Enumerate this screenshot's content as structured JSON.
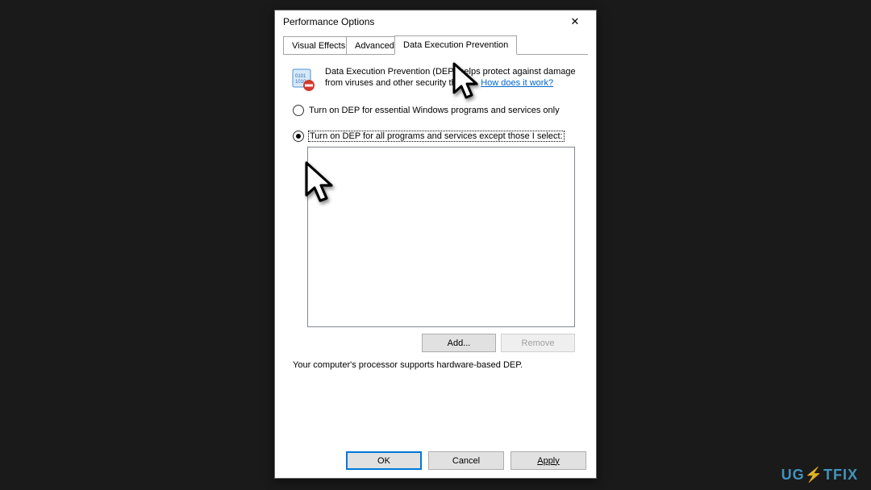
{
  "window": {
    "title": "Performance Options",
    "close_symbol": "✕"
  },
  "tabs": {
    "visual_effects": "Visual Effects",
    "advanced": "Advanced",
    "dep": "Data Execution Prevention"
  },
  "description": {
    "text_before_link": "Data Execution Prevention (DEP) helps protect against damage from viruses and other security threats. ",
    "link_text": "How does it work?"
  },
  "radios": {
    "option1": "Turn on DEP for essential Windows programs and services only",
    "option2": "Turn on DEP for all programs and services except those I select:",
    "selected": "option2"
  },
  "buttons": {
    "add": "Add...",
    "remove": "Remove",
    "ok": "OK",
    "cancel": "Cancel",
    "apply": "Apply"
  },
  "status": "Your computer's processor supports hardware-based DEP.",
  "watermark": "UGETFIX"
}
